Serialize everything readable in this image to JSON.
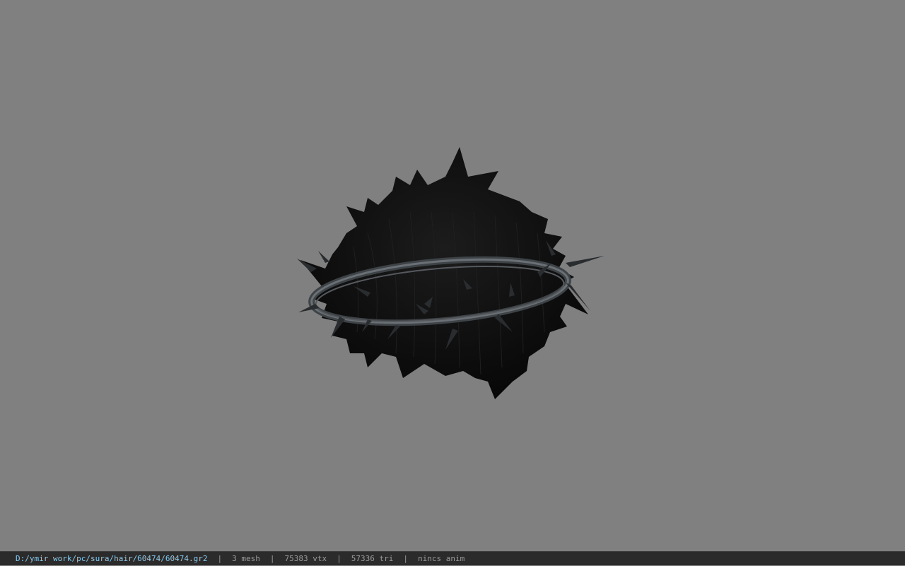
{
  "viewport": {
    "background_color": "#808080",
    "model": {
      "label": "hair model with thorn crown",
      "hair_color": "#0d0d0d",
      "crown_color": "#4a4f53"
    }
  },
  "statusbar": {
    "file_path": "D:/ymir work/pc/sura/hair/60474/60474.gr2",
    "separator": "|",
    "mesh_count": "3 mesh",
    "vertex_count": "75383 vtx",
    "triangle_count": "57336 tri",
    "anim_status": "nincs anim",
    "path_color": "#8fc8e8",
    "text_color": "#9a9a9a"
  }
}
